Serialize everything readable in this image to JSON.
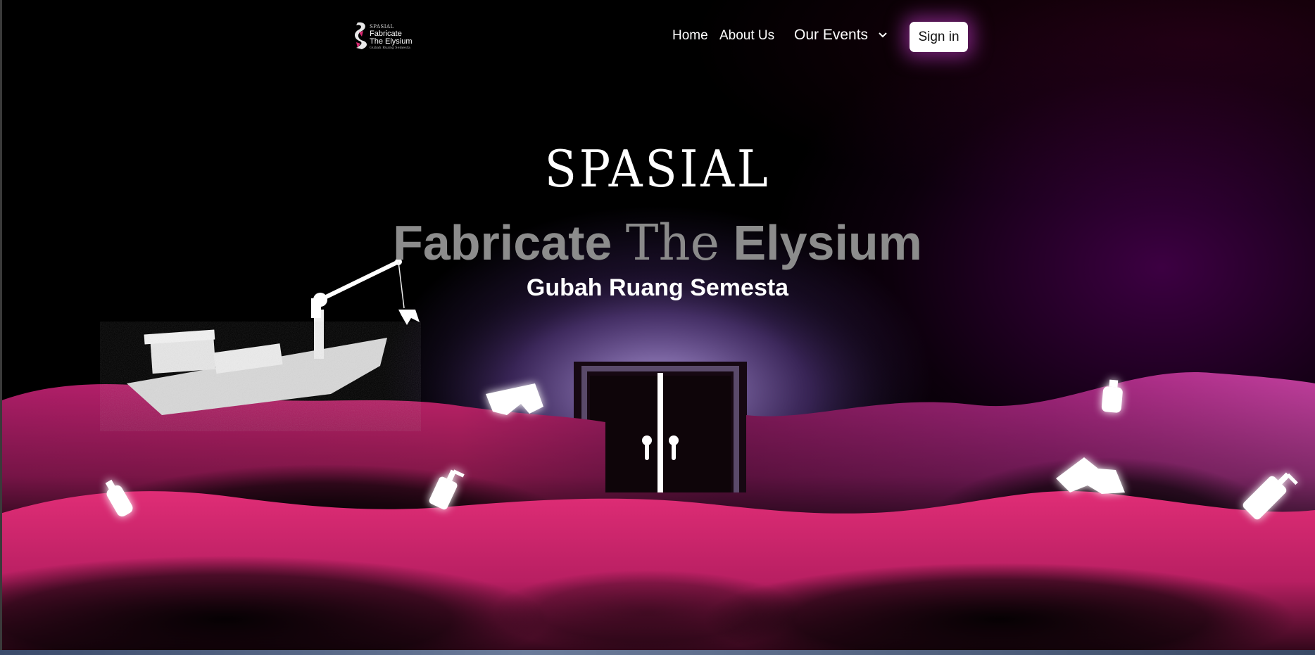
{
  "nav": {
    "logo": {
      "line1": "SPASIAL",
      "line2": "Fabricate",
      "line3": "The Elysium",
      "line4": "Gubah Ruang Semesta"
    },
    "home_label": "Home",
    "about_label": "About Us",
    "events_label": "Our Events",
    "signin_label": "Sign in"
  },
  "hero": {
    "brand": "SPASIAL",
    "title_part1": "Fabricate",
    "title_part2": "The",
    "title_part3": "Elysium",
    "subtitle": "Gubah Ruang Semesta"
  },
  "colors": {
    "wave_pink": "#d6296f",
    "wave_magenta": "#b3237d",
    "glow_purple": "#8c6ebe",
    "signin_bg": "#ffffff",
    "signin_glow": "#c83cd2",
    "title_gray": "#8c8c8c"
  },
  "icons": {
    "events_chevron": "chevron-down-icon",
    "logo": "spasial-logo-icon"
  }
}
